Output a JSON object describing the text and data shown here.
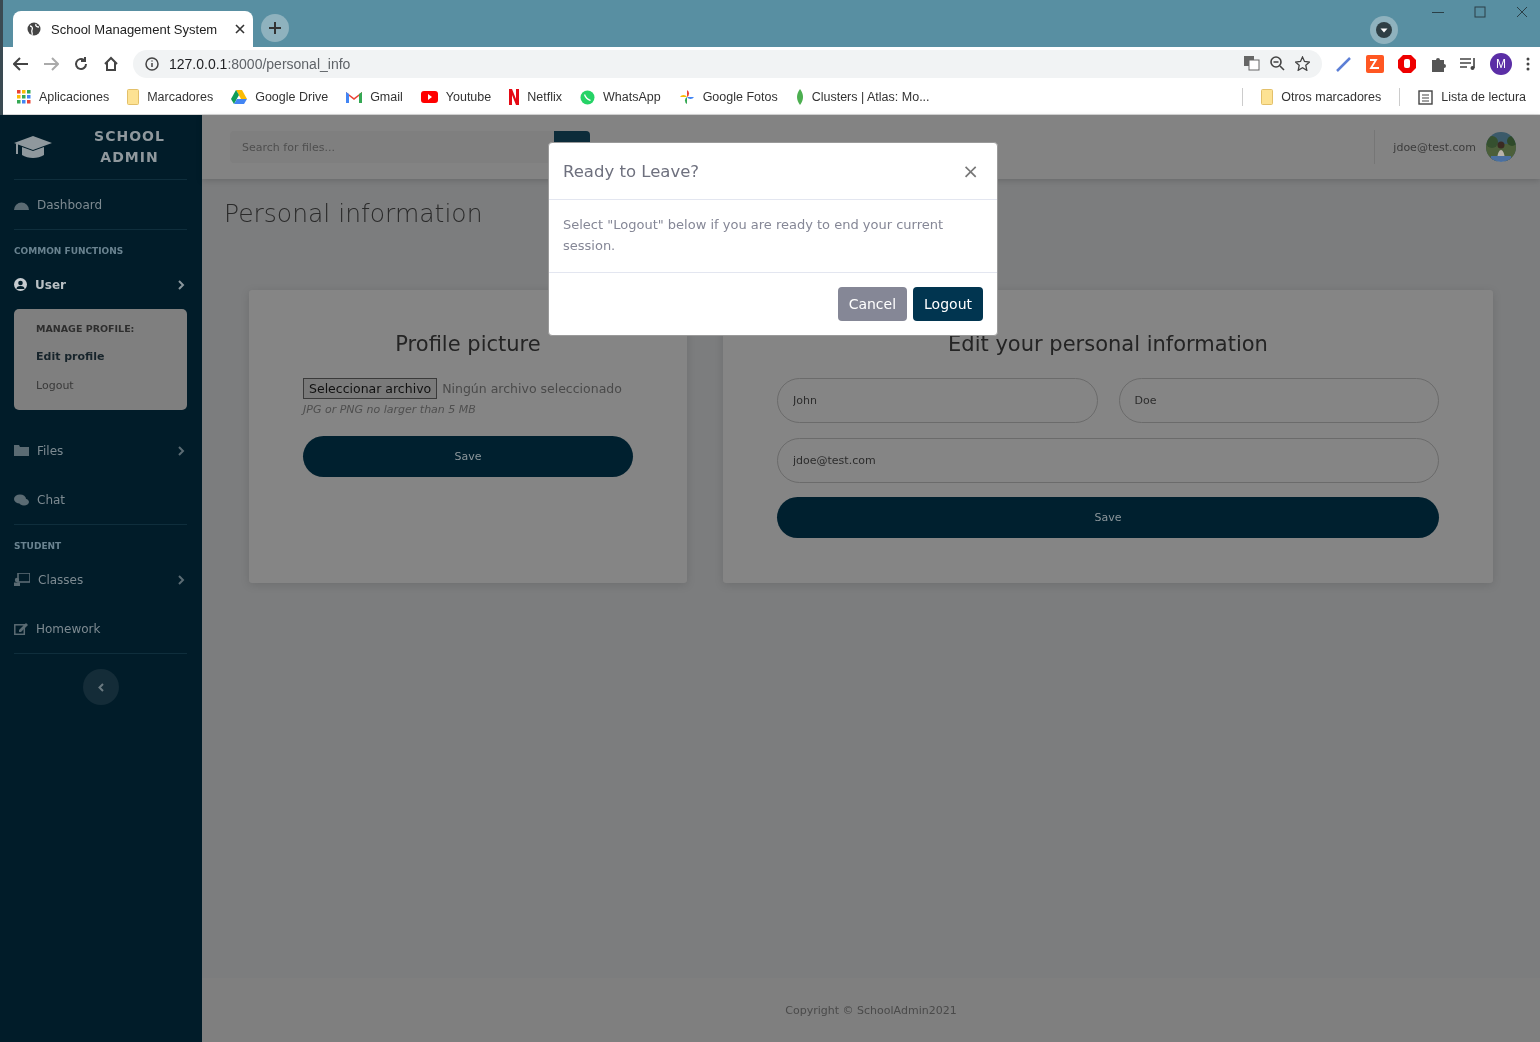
{
  "browser": {
    "tab_title": "School Management System",
    "url_host": "127.0.0.1",
    "url_path": ":8000/personal_info",
    "profile_initial": "M",
    "bookmarks": [
      {
        "label": "Aplicaciones",
        "kind": "apps"
      },
      {
        "label": "Marcadores",
        "kind": "folder"
      },
      {
        "label": "Google Drive",
        "kind": "drive"
      },
      {
        "label": "Gmail",
        "kind": "gmail"
      },
      {
        "label": "Youtube",
        "kind": "youtube"
      },
      {
        "label": "Netflix",
        "kind": "netflix"
      },
      {
        "label": "WhatsApp",
        "kind": "whatsapp"
      },
      {
        "label": "Google Fotos",
        "kind": "photos"
      },
      {
        "label": "Clusters | Atlas: Mo...",
        "kind": "leaf"
      }
    ],
    "other_bookmarks": "Otros marcadores",
    "reading_list": "Lista de lectura"
  },
  "sidebar": {
    "brand": [
      "SCHOOL",
      "ADMIN"
    ],
    "items": [
      {
        "kind": "divider"
      },
      {
        "kind": "link",
        "label": "Dashboard"
      },
      {
        "kind": "divider"
      },
      {
        "kind": "heading",
        "label": "COMMON FUNCTIONS"
      },
      {
        "kind": "link",
        "label": "User",
        "chevron": true,
        "expanded": true
      },
      {
        "kind": "submenu",
        "heading": "MANAGE PROFILE:",
        "entries": [
          {
            "label": "Edit profile",
            "selected": true
          },
          {
            "label": "Logout",
            "selected": false
          }
        ]
      },
      {
        "kind": "link",
        "label": "Files",
        "chevron": true,
        "expanded": false
      },
      {
        "kind": "link",
        "label": "Chat"
      },
      {
        "kind": "divider"
      },
      {
        "kind": "heading",
        "label": "STUDENT"
      },
      {
        "kind": "link",
        "label": "Classes",
        "chevron": true,
        "expanded": false
      },
      {
        "kind": "link",
        "label": "Homework"
      },
      {
        "kind": "divider"
      }
    ]
  },
  "topbar": {
    "search_placeholder": "Search for files...",
    "user_email": "jdoe@test.com"
  },
  "page_title": "Personal information",
  "profile_card": {
    "title": "Profile picture",
    "file_button": "Seleccionar archivo",
    "file_status": "Ningún archivo seleccionado",
    "hint": "JPG or PNG no larger than 5 MB",
    "save": "Save"
  },
  "info_card": {
    "title": "Edit your personal information",
    "fields": [
      {
        "value": "John"
      },
      {
        "value": "Doe"
      },
      {
        "value": "jdoe@test.com"
      }
    ],
    "save": "Save"
  },
  "modal": {
    "title": "Ready to Leave?",
    "close": "×",
    "body": "Select \"Logout\" below if you are ready to end your current session.",
    "buttons": [
      {
        "label": "Cancel",
        "kind": "secondary"
      },
      {
        "label": "Logout",
        "kind": "primary"
      }
    ]
  },
  "footer": "Copyright © SchoolAdmin2021"
}
